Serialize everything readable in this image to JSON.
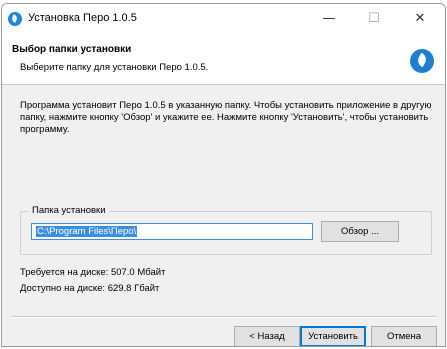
{
  "window": {
    "title": "Установка Перо 1.0.5",
    "controls": {
      "minimize": "—",
      "maximize": "☐",
      "close": "✕"
    }
  },
  "header": {
    "title": "Выбор папки установки",
    "subtitle": "Выберите папку для установки Перо 1.0.5.",
    "icon": "feather-pen-icon"
  },
  "description": "Программа установит Перо 1.0.5 в указанную папку. Чтобы установить приложение в другую папку, нажмите кнопку 'Обзор' и укажите ее. Нажмите кнопку 'Установить', чтобы установить программу.",
  "install_folder": {
    "legend": "Папка установки",
    "path": "C:\\Program Files\\Перо\\",
    "browse_label": "Обзор ..."
  },
  "disk": {
    "required": "Требуется на диске: 507.0 Мбайт",
    "available": "Доступно на диске: 629.8 Гбайт"
  },
  "footer": {
    "back_label": "< Назад",
    "install_label": "Установить",
    "cancel_label": "Отмена"
  },
  "colors": {
    "accent": "#1e7fd0",
    "selection": "#3c8ee0",
    "dialog_bg": "#f0f0f0"
  }
}
